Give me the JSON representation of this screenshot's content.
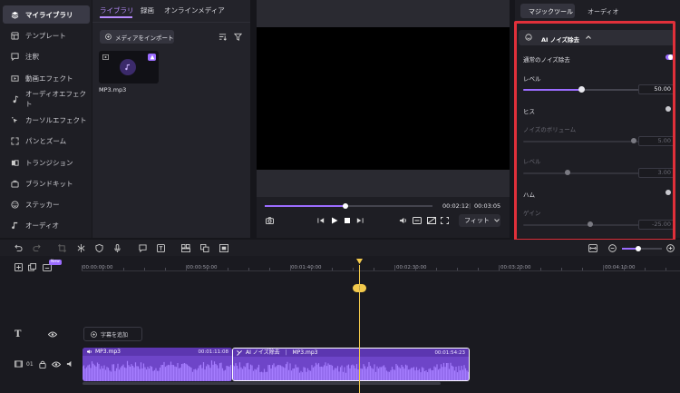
{
  "sidebar": {
    "items": [
      {
        "label": "マイライブラリ",
        "icon": "layers-icon",
        "active": true
      },
      {
        "label": "テンプレート",
        "icon": "template-icon"
      },
      {
        "label": "注釈",
        "icon": "annotation-icon"
      },
      {
        "label": "動画エフェクト",
        "icon": "video-effect-icon"
      },
      {
        "label": "オーディオエフェクト",
        "icon": "audio-effect-icon"
      },
      {
        "label": "カーソルエフェクト",
        "icon": "cursor-effect-icon"
      },
      {
        "label": "パンとズーム",
        "icon": "pan-zoom-icon"
      },
      {
        "label": "トランジション",
        "icon": "transition-icon"
      },
      {
        "label": "ブランドキット",
        "icon": "brand-kit-icon"
      },
      {
        "label": "ステッカー",
        "icon": "sticker-icon"
      },
      {
        "label": "オーディオ",
        "icon": "audio-icon"
      }
    ]
  },
  "media": {
    "tabs": [
      "ライブラリ",
      "録画",
      "オンラインメディア"
    ],
    "import_label": "メディアをインポート",
    "file_name": "MP3.mp3"
  },
  "preview": {
    "current_time": "00:02:12",
    "total_time": "00:03:05",
    "progress": 0.48,
    "fit_label": "フィット"
  },
  "magic": {
    "tabs": [
      "マジックツール",
      "オーディオ"
    ],
    "section_title": "AI ノイズ除去",
    "normal_label": "通常のノイズ除去",
    "level_label": "レベル",
    "level_value": "50.00",
    "level_fraction": 0.5,
    "hiss_label": "ヒス",
    "noise_volume_label": "ノイズのボリューム",
    "noise_volume_value": "5.00",
    "noise_volume_fraction": 0.95,
    "hiss_level_label": "レベル",
    "hiss_level_value": "3.00",
    "hiss_level_fraction": 0.38,
    "hum_label": "ハム",
    "gain_label": "ゲイン",
    "gain_value": "-25.00",
    "gain_fraction": 0.58
  },
  "timeline": {
    "new_badge": "New",
    "ruler": [
      "00:00:00:00",
      "00:00:50:00",
      "00:01:40:00",
      "00:02:30:00",
      "00:03:20:00",
      "00:04:10:00"
    ],
    "playhead_label": "⋮",
    "subtitle_add": "字幕を追加",
    "track_number": "01",
    "clips": [
      {
        "name": "MP3.mp3",
        "duration": "00:01:11:08",
        "effect": ""
      },
      {
        "name": "MP3.mp3",
        "duration": "00:01:54:23",
        "effect": "AI ノイズ除去"
      }
    ]
  },
  "colors": {
    "accent": "#9b6cff",
    "highlight": "#e0303a",
    "clip": "#6e45c8",
    "playhead": "#f2c94c"
  }
}
